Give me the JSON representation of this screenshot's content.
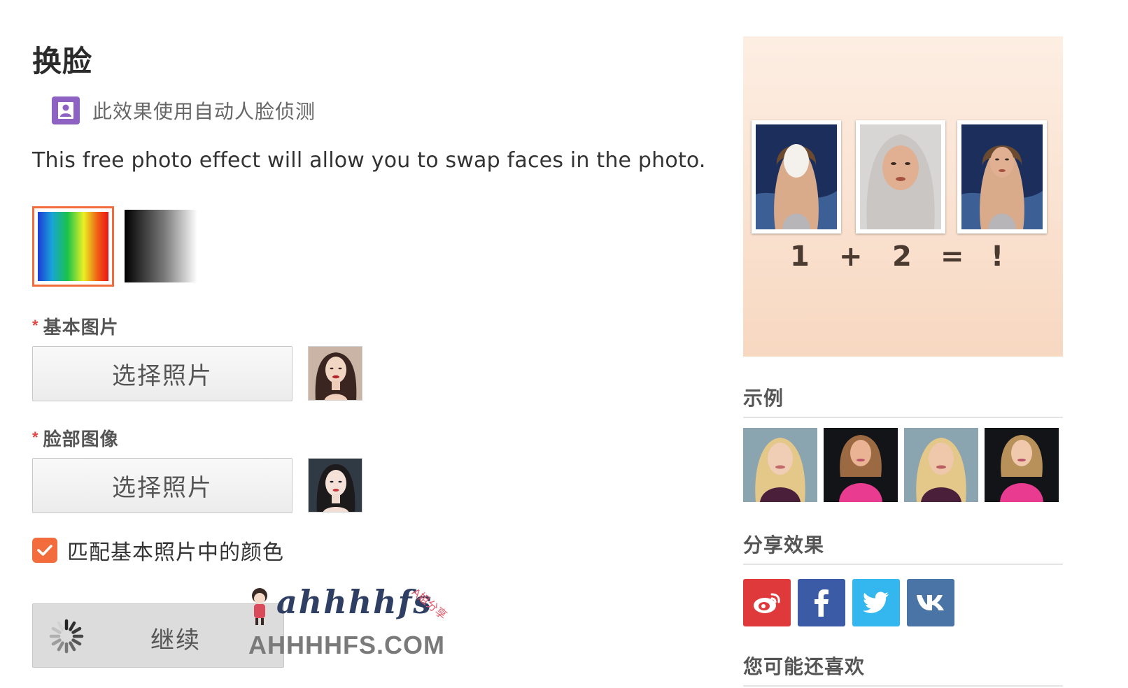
{
  "page": {
    "title": "换脸",
    "face_detect_note": "此效果使用自动人脸侦测",
    "description": "This free photo effect will allow you to swap faces in the photo."
  },
  "filters": {
    "options": [
      "color",
      "grayscale"
    ],
    "selected": "color",
    "accent": "#f36c3b"
  },
  "fields": {
    "base_image": {
      "required_mark": "*",
      "label": "基本图片",
      "button_label": "选择照片"
    },
    "face_image": {
      "required_mark": "*",
      "label": "脸部图像",
      "button_label": "选择照片"
    }
  },
  "options": {
    "match_color": {
      "label": "匹配基本照片中的颜色",
      "checked": true
    }
  },
  "actions": {
    "continue_label": "继续",
    "loading": true
  },
  "watermark": {
    "script_text": "ahhhhfs",
    "domain_text": "AHHHHFS.COM",
    "tag_text": "A姐分享"
  },
  "sidebar": {
    "promo": {
      "symbols": [
        "1",
        "+",
        "2",
        "=",
        "!"
      ]
    },
    "examples_heading": "示例",
    "share_heading": "分享效果",
    "share": [
      {
        "network": "weibo",
        "color": "#e0393c",
        "icon": "weibo-icon"
      },
      {
        "network": "facebook",
        "color": "#3b5ba6",
        "icon": "facebook-icon"
      },
      {
        "network": "twitter",
        "color": "#34b7ee",
        "icon": "twitter-icon"
      },
      {
        "network": "vk",
        "color": "#4a74a5",
        "icon": "vk-icon"
      }
    ],
    "recommend_heading": "您可能还喜欢"
  }
}
